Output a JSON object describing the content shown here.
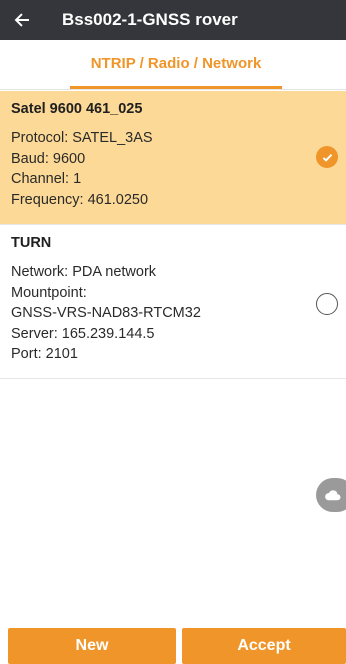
{
  "appbar": {
    "title": "Bss002-1-GNSS rover"
  },
  "tab": {
    "label": "NTRIP / Radio / Network"
  },
  "items": [
    {
      "title": "Satel 9600 461_025",
      "lines": [
        "Protocol: SATEL_3AS",
        "Baud: 9600",
        "Channel: 1",
        "Frequency: 461.0250"
      ],
      "selected": true
    },
    {
      "title": "TURN",
      "lines": [
        "Network: PDA network",
        "Mountpoint:",
        "GNSS-VRS-NAD83-RTCM32",
        "Server: 165.239.144.5",
        "Port: 2101"
      ],
      "selected": false
    }
  ],
  "buttons": {
    "new_label": "New",
    "accept_label": "Accept"
  },
  "colors": {
    "accent": "#f0952a",
    "selected_bg": "#fcd996",
    "appbar": "#35363b"
  },
  "icons": {
    "back": "arrow-left-icon",
    "selected": "checkmark-circle-icon",
    "unselected": "radio-empty-icon",
    "fab": "cloud-icon"
  }
}
